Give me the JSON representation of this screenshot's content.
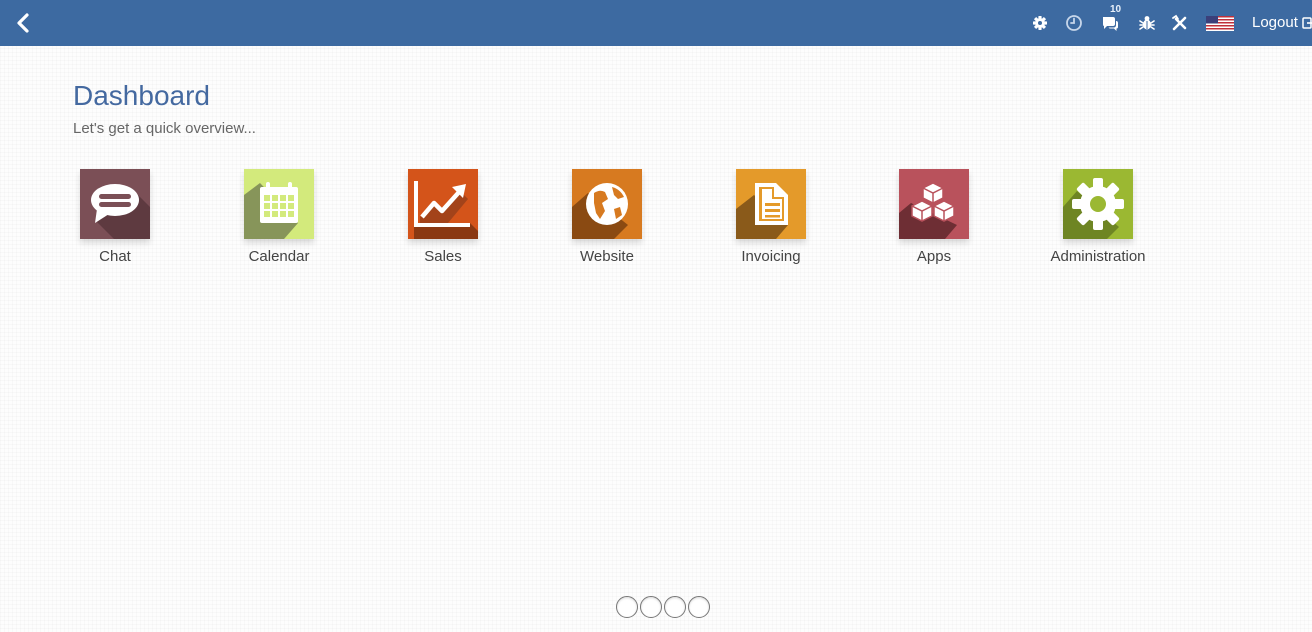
{
  "topbar": {
    "back_icon": "chevron-left-icon",
    "icons": [
      "gear-icon",
      "clock-icon",
      "chat-bubbles-icon",
      "bug-icon",
      "tools-icon"
    ],
    "messages_badge": "10",
    "language_flag": "us-flag-icon",
    "logout_label": "Logout",
    "background_color": "#3d6aa1"
  },
  "header": {
    "title": "Dashboard",
    "subtitle": "Let's get a quick overview..."
  },
  "apps": [
    {
      "label": "Chat",
      "icon": "chat-icon",
      "color": "#7b4f56"
    },
    {
      "label": "Calendar",
      "icon": "calendar-icon",
      "color": "#cfe87a"
    },
    {
      "label": "Sales",
      "icon": "sales-chart-icon",
      "color": "#d4541a"
    },
    {
      "label": "Website",
      "icon": "globe-icon",
      "color": "#d77a20"
    },
    {
      "label": "Invoicing",
      "icon": "document-icon",
      "color": "#e49a2a"
    },
    {
      "label": "Apps",
      "icon": "cubes-icon",
      "color": "#b9525c"
    },
    {
      "label": "Administration",
      "icon": "gear-icon",
      "color": "#9bb832"
    }
  ],
  "pager": {
    "pages": 4,
    "current": 1
  }
}
